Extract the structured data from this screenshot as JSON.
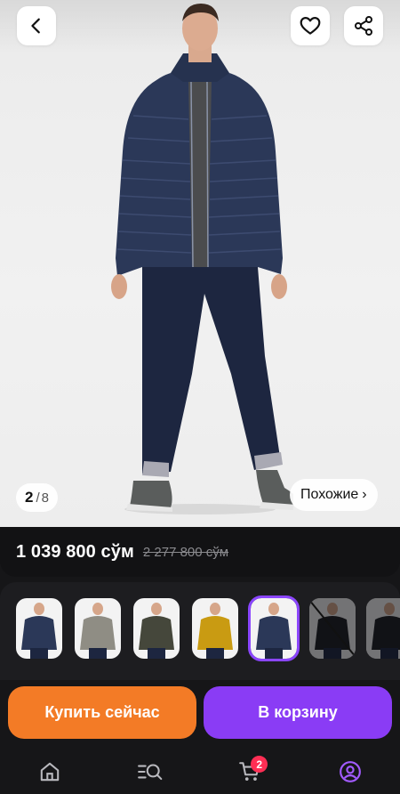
{
  "pager": {
    "current": "2",
    "separator": "/",
    "total": "8"
  },
  "similar": {
    "label": "Похожие",
    "chevron": "›"
  },
  "price": {
    "current": "1 039 800 сўм",
    "old": "2 277 800 сўм"
  },
  "variants": [
    {
      "color": "navy",
      "selected": false
    },
    {
      "color": "gray",
      "selected": false
    },
    {
      "color": "olive",
      "selected": false
    },
    {
      "color": "mustard",
      "selected": false
    },
    {
      "color": "navy",
      "selected": true
    },
    {
      "color": "black",
      "selected": false,
      "unavailable": true
    },
    {
      "color": "black",
      "selected": false,
      "unavailable": true
    }
  ],
  "actions": {
    "buy_now": "Купить сейчас",
    "add_to_cart": "В корзину"
  },
  "nav": {
    "items": [
      {
        "icon": "home-icon"
      },
      {
        "icon": "catalog-search-icon"
      },
      {
        "icon": "cart-icon",
        "badge": "2"
      },
      {
        "icon": "profile-icon",
        "active": true
      }
    ]
  },
  "colors": {
    "accent": "#8a3cf5",
    "buy": "#f37b26",
    "badge": "#ff2e54",
    "background": "#161618"
  },
  "icons": {
    "back": "chevron-left-icon",
    "favorite": "heart-icon",
    "share": "share-icon"
  }
}
